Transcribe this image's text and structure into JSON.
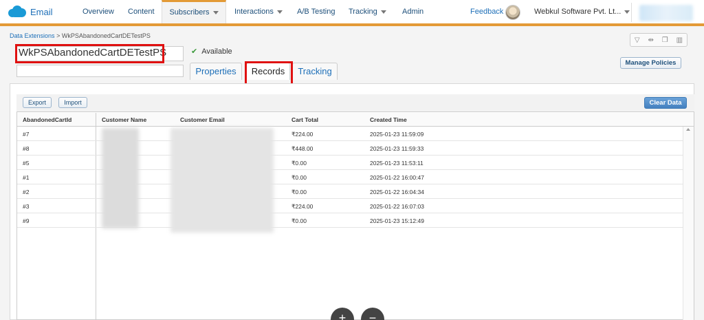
{
  "app": {
    "title": "Email"
  },
  "nav": {
    "items": [
      {
        "label": "Overview"
      },
      {
        "label": "Content"
      },
      {
        "label": "Subscribers"
      },
      {
        "label": "Interactions"
      },
      {
        "label": "A/B Testing"
      },
      {
        "label": "Tracking"
      },
      {
        "label": "Admin"
      }
    ],
    "feedback": "Feedback",
    "org": "Webkul Software Pvt. Lt..."
  },
  "breadcrumb": {
    "parent": "Data Extensions",
    "separator": ">",
    "current": "WkPSAbandonedCartDETestPS"
  },
  "extension": {
    "name": "WkPSAbandonedCartDETestPS",
    "status": "Available"
  },
  "tabs": [
    {
      "label": "Properties"
    },
    {
      "label": "Records"
    },
    {
      "label": "Tracking"
    }
  ],
  "buttons": {
    "manage_policies": "Manage Policies",
    "export": "Export",
    "import": "Import",
    "clear_data": "Clear Data"
  },
  "table": {
    "columns": [
      "AbandonedCartId",
      "Customer Name",
      "Customer Email",
      "Cart Total",
      "Created Time"
    ],
    "rows": [
      {
        "id": "#7",
        "total": "₹224.00",
        "created": "2025-01-23 11:59:09"
      },
      {
        "id": "#8",
        "total": "₹448.00",
        "created": "2025-01-23 11:59:33"
      },
      {
        "id": "#5",
        "total": "₹0.00",
        "created": "2025-01-23 11:53:11"
      },
      {
        "id": "#1",
        "total": "₹0.00",
        "created": "2025-01-22 16:00:47"
      },
      {
        "id": "#2",
        "total": "₹0.00",
        "created": "2025-01-22 16:04:34"
      },
      {
        "id": "#3",
        "total": "₹224.00",
        "created": "2025-01-22 16:07:03"
      },
      {
        "id": "#9",
        "total": "₹0.00",
        "created": "2025-01-23 15:12:49"
      }
    ]
  },
  "colors": {
    "accent": "#e39a36",
    "link": "#1d6fb8",
    "highlight": "#e01010",
    "primary_button": "#4481c0"
  },
  "icons": [
    "salesforce-cloud-icon",
    "caret-down-icon",
    "check-icon",
    "filter-icon",
    "swap-icon",
    "copy-icon",
    "trash-icon",
    "scroll-up-icon"
  ]
}
